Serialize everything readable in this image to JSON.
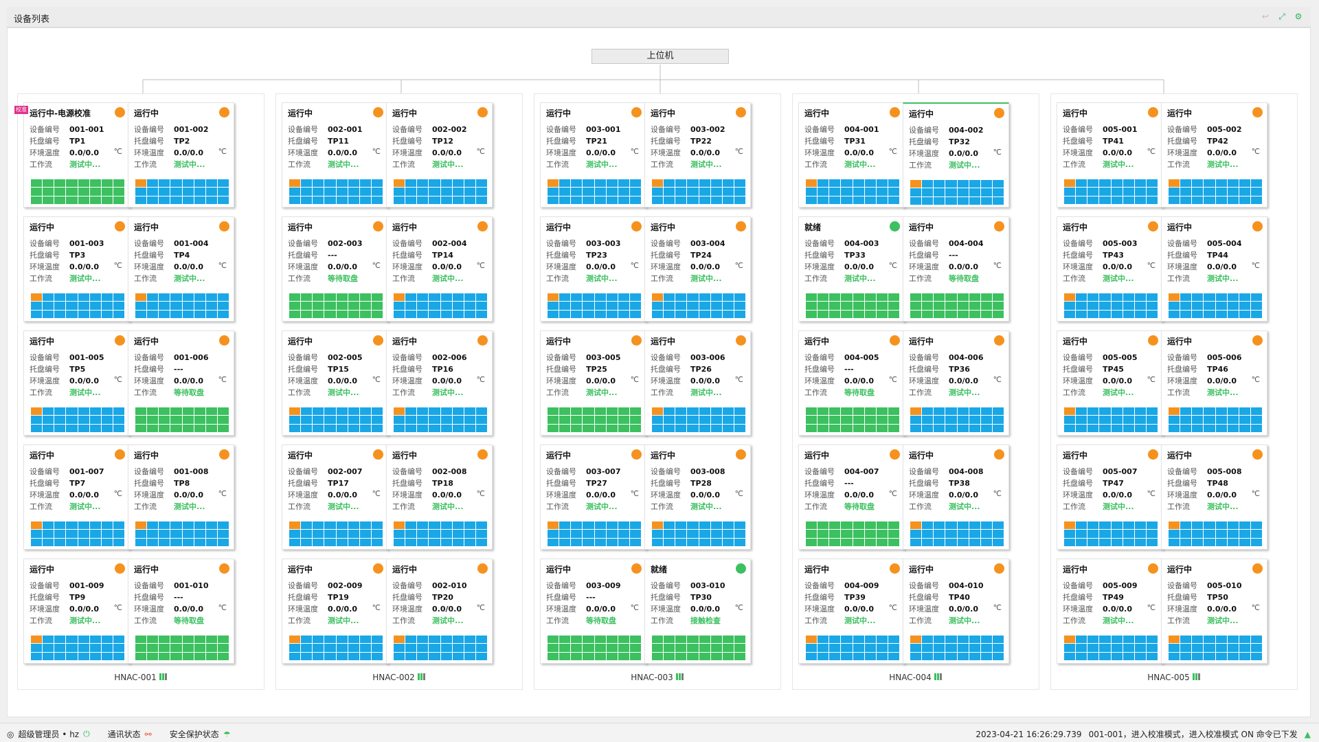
{
  "window": {
    "title": "设备列表",
    "tools": [
      "return-icon",
      "pin-icon",
      "gear-icon"
    ]
  },
  "host": {
    "label": "上位机"
  },
  "labels": {
    "device": "设备编号",
    "tray": "托盘编号",
    "temp": "环境温度",
    "flow": "工作流",
    "unit": "℃"
  },
  "colors": {
    "orange": "#f5921e",
    "green": "#3cc060",
    "blue": "#1aa7e6",
    "tag": "#e0308a"
  },
  "groups": [
    {
      "name": "HNAC-001",
      "devices": [
        {
          "status": "运行中-电源校准",
          "tag": "校准",
          "dot": "orange",
          "id": "001-001",
          "tray": "TP1",
          "temp": "0.0/0.0",
          "flow": "测试中...",
          "grid": "green"
        },
        {
          "status": "运行中",
          "dot": "orange",
          "id": "001-002",
          "tray": "TP2",
          "temp": "0.0/0.0",
          "flow": "测试中...",
          "grid": "blue"
        },
        {
          "status": "运行中",
          "dot": "orange",
          "id": "001-003",
          "tray": "TP3",
          "temp": "0.0/0.0",
          "flow": "测试中...",
          "grid": "blue"
        },
        {
          "status": "运行中",
          "dot": "orange",
          "id": "001-004",
          "tray": "TP4",
          "temp": "0.0/0.0",
          "flow": "测试中...",
          "grid": "blue"
        },
        {
          "status": "运行中",
          "dot": "orange",
          "id": "001-005",
          "tray": "TP5",
          "temp": "0.0/0.0",
          "flow": "测试中...",
          "grid": "blue"
        },
        {
          "status": "运行中",
          "dot": "orange",
          "id": "001-006",
          "tray": "---",
          "temp": "0.0/0.0",
          "flow": "等待取盘",
          "grid": "green"
        },
        {
          "status": "运行中",
          "dot": "orange",
          "id": "001-007",
          "tray": "TP7",
          "temp": "0.0/0.0",
          "flow": "测试中...",
          "grid": "blue"
        },
        {
          "status": "运行中",
          "dot": "orange",
          "id": "001-008",
          "tray": "TP8",
          "temp": "0.0/0.0",
          "flow": "测试中...",
          "grid": "blue"
        },
        {
          "status": "运行中",
          "dot": "orange",
          "id": "001-009",
          "tray": "TP9",
          "temp": "0.0/0.0",
          "flow": "测试中...",
          "grid": "blue"
        },
        {
          "status": "运行中",
          "dot": "orange",
          "id": "001-010",
          "tray": "---",
          "temp": "0.0/0.0",
          "flow": "等待取盘",
          "grid": "green"
        }
      ]
    },
    {
      "name": "HNAC-002",
      "devices": [
        {
          "status": "运行中",
          "dot": "orange",
          "id": "002-001",
          "tray": "TP11",
          "temp": "0.0/0.0",
          "flow": "测试中...",
          "grid": "blue"
        },
        {
          "status": "运行中",
          "dot": "orange",
          "id": "002-002",
          "tray": "TP12",
          "temp": "0.0/0.0",
          "flow": "测试中...",
          "grid": "blue"
        },
        {
          "status": "运行中",
          "dot": "orange",
          "id": "002-003",
          "tray": "---",
          "temp": "0.0/0.0",
          "flow": "等待取盘",
          "grid": "green"
        },
        {
          "status": "运行中",
          "dot": "orange",
          "id": "002-004",
          "tray": "TP14",
          "temp": "0.0/0.0",
          "flow": "测试中...",
          "grid": "blue"
        },
        {
          "status": "运行中",
          "dot": "orange",
          "id": "002-005",
          "tray": "TP15",
          "temp": "0.0/0.0",
          "flow": "测试中...",
          "grid": "blue"
        },
        {
          "status": "运行中",
          "dot": "orange",
          "id": "002-006",
          "tray": "TP16",
          "temp": "0.0/0.0",
          "flow": "测试中...",
          "grid": "blue"
        },
        {
          "status": "运行中",
          "dot": "orange",
          "id": "002-007",
          "tray": "TP17",
          "temp": "0.0/0.0",
          "flow": "测试中...",
          "grid": "blue"
        },
        {
          "status": "运行中",
          "dot": "orange",
          "id": "002-008",
          "tray": "TP18",
          "temp": "0.0/0.0",
          "flow": "测试中...",
          "grid": "blue"
        },
        {
          "status": "运行中",
          "dot": "orange",
          "id": "002-009",
          "tray": "TP19",
          "temp": "0.0/0.0",
          "flow": "测试中...",
          "grid": "blue"
        },
        {
          "status": "运行中",
          "dot": "orange",
          "id": "002-010",
          "tray": "TP20",
          "temp": "0.0/0.0",
          "flow": "测试中...",
          "grid": "blue"
        }
      ]
    },
    {
      "name": "HNAC-003",
      "devices": [
        {
          "status": "运行中",
          "dot": "orange",
          "id": "003-001",
          "tray": "TP21",
          "temp": "0.0/0.0",
          "flow": "测试中...",
          "grid": "blue"
        },
        {
          "status": "运行中",
          "dot": "orange",
          "id": "003-002",
          "tray": "TP22",
          "temp": "0.0/0.0",
          "flow": "测试中...",
          "grid": "blue"
        },
        {
          "status": "运行中",
          "dot": "orange",
          "id": "003-003",
          "tray": "TP23",
          "temp": "0.0/0.0",
          "flow": "测试中...",
          "grid": "blue"
        },
        {
          "status": "运行中",
          "dot": "orange",
          "id": "003-004",
          "tray": "TP24",
          "temp": "0.0/0.0",
          "flow": "测试中...",
          "grid": "blue"
        },
        {
          "status": "运行中",
          "dot": "orange",
          "id": "003-005",
          "tray": "TP25",
          "temp": "0.0/0.0",
          "flow": "测试中...",
          "grid": "green"
        },
        {
          "status": "运行中",
          "dot": "orange",
          "id": "003-006",
          "tray": "TP26",
          "temp": "0.0/0.0",
          "flow": "测试中...",
          "grid": "blue"
        },
        {
          "status": "运行中",
          "dot": "orange",
          "id": "003-007",
          "tray": "TP27",
          "temp": "0.0/0.0",
          "flow": "测试中...",
          "grid": "blue"
        },
        {
          "status": "运行中",
          "dot": "orange",
          "id": "003-008",
          "tray": "TP28",
          "temp": "0.0/0.0",
          "flow": "测试中...",
          "grid": "blue"
        },
        {
          "status": "运行中",
          "dot": "orange",
          "id": "003-009",
          "tray": "---",
          "temp": "0.0/0.0",
          "flow": "等待取盘",
          "grid": "green"
        },
        {
          "status": "就绪",
          "dot": "green",
          "id": "003-010",
          "tray": "TP30",
          "temp": "0.0/0.0",
          "flow": "接触检查",
          "grid": "green"
        }
      ]
    },
    {
      "name": "HNAC-004",
      "devices": [
        {
          "status": "运行中",
          "dot": "orange",
          "id": "004-001",
          "tray": "TP31",
          "temp": "0.0/0.0",
          "flow": "测试中...",
          "grid": "blue"
        },
        {
          "status": "运行中",
          "dot": "orange",
          "id": "004-002",
          "tray": "TP32",
          "temp": "0.0/0.0",
          "flow": "测试中...",
          "grid": "blue",
          "selected": true
        },
        {
          "status": "就绪",
          "dot": "green",
          "id": "004-003",
          "tray": "TP33",
          "temp": "0.0/0.0",
          "flow": "测试中...",
          "grid": "green"
        },
        {
          "status": "运行中",
          "dot": "orange",
          "id": "004-004",
          "tray": "---",
          "temp": "0.0/0.0",
          "flow": "等待取盘",
          "grid": "green"
        },
        {
          "status": "运行中",
          "dot": "orange",
          "id": "004-005",
          "tray": "---",
          "temp": "0.0/0.0",
          "flow": "等待取盘",
          "grid": "green"
        },
        {
          "status": "运行中",
          "dot": "orange",
          "id": "004-006",
          "tray": "TP36",
          "temp": "0.0/0.0",
          "flow": "测试中...",
          "grid": "blue"
        },
        {
          "status": "运行中",
          "dot": "orange",
          "id": "004-007",
          "tray": "---",
          "temp": "0.0/0.0",
          "flow": "等待取盘",
          "grid": "green"
        },
        {
          "status": "运行中",
          "dot": "orange",
          "id": "004-008",
          "tray": "TP38",
          "temp": "0.0/0.0",
          "flow": "测试中...",
          "grid": "blue"
        },
        {
          "status": "运行中",
          "dot": "orange",
          "id": "004-009",
          "tray": "TP39",
          "temp": "0.0/0.0",
          "flow": "测试中...",
          "grid": "blue"
        },
        {
          "status": "运行中",
          "dot": "orange",
          "id": "004-010",
          "tray": "TP40",
          "temp": "0.0/0.0",
          "flow": "测试中...",
          "grid": "blue"
        }
      ]
    },
    {
      "name": "HNAC-005",
      "devices": [
        {
          "status": "运行中",
          "dot": "orange",
          "id": "005-001",
          "tray": "TP41",
          "temp": "0.0/0.0",
          "flow": "测试中...",
          "grid": "blue"
        },
        {
          "status": "运行中",
          "dot": "orange",
          "id": "005-002",
          "tray": "TP42",
          "temp": "0.0/0.0",
          "flow": "测试中...",
          "grid": "blue"
        },
        {
          "status": "运行中",
          "dot": "orange",
          "id": "005-003",
          "tray": "TP43",
          "temp": "0.0/0.0",
          "flow": "测试中...",
          "grid": "blue"
        },
        {
          "status": "运行中",
          "dot": "orange",
          "id": "005-004",
          "tray": "TP44",
          "temp": "0.0/0.0",
          "flow": "测试中...",
          "grid": "blue"
        },
        {
          "status": "运行中",
          "dot": "orange",
          "id": "005-005",
          "tray": "TP45",
          "temp": "0.0/0.0",
          "flow": "测试中...",
          "grid": "blue"
        },
        {
          "status": "运行中",
          "dot": "orange",
          "id": "005-006",
          "tray": "TP46",
          "temp": "0.0/0.0",
          "flow": "测试中...",
          "grid": "blue"
        },
        {
          "status": "运行中",
          "dot": "orange",
          "id": "005-007",
          "tray": "TP47",
          "temp": "0.0/0.0",
          "flow": "测试中...",
          "grid": "blue"
        },
        {
          "status": "运行中",
          "dot": "orange",
          "id": "005-008",
          "tray": "TP48",
          "temp": "0.0/0.0",
          "flow": "测试中...",
          "grid": "blue"
        },
        {
          "status": "运行中",
          "dot": "orange",
          "id": "005-009",
          "tray": "TP49",
          "temp": "0.0/0.0",
          "flow": "测试中...",
          "grid": "blue"
        },
        {
          "status": "运行中",
          "dot": "orange",
          "id": "005-010",
          "tray": "TP50",
          "temp": "0.0/0.0",
          "flow": "测试中...",
          "grid": "blue"
        }
      ]
    }
  ],
  "status": {
    "user": "超级管理员 • hz",
    "comm": "通讯状态",
    "safety": "安全保护状态",
    "datetime": "2023-04-21 16:26:29.739",
    "message": "001-001，进入校准模式，进入校准模式 ON 命令已下发"
  }
}
